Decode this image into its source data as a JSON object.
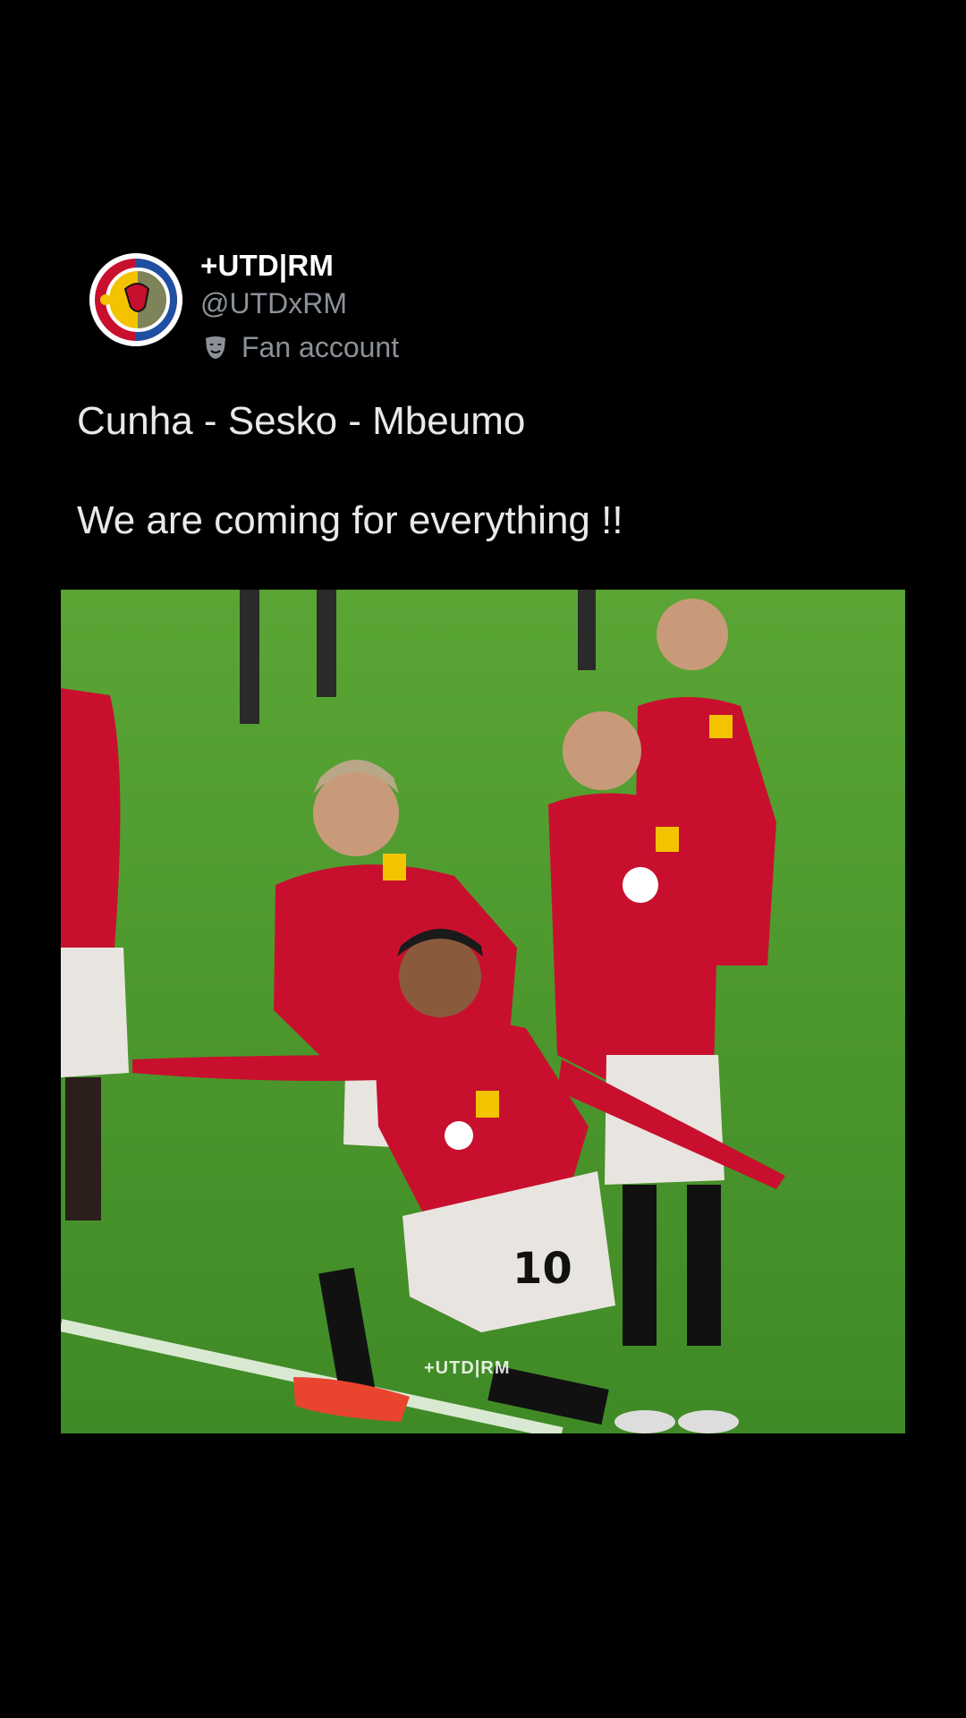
{
  "account": {
    "display_name": "+UTD|RM",
    "handle": "@UTDxRM",
    "label": "Fan account",
    "label_icon": "mask-icon",
    "avatar_icon": "club-crest-avatar"
  },
  "tweet": {
    "line1": "Cunha - Sesko - Mbeumo",
    "line2": "We are coming for everything !!"
  },
  "media": {
    "description_icon": "football-celebration-photo",
    "watermark": "+UTD|RM"
  },
  "colors": {
    "background": "#000000",
    "text": "#e7e9ea",
    "muted": "#8b9197",
    "pitch": "#4f9a2f",
    "kit_red": "#c8102e"
  }
}
